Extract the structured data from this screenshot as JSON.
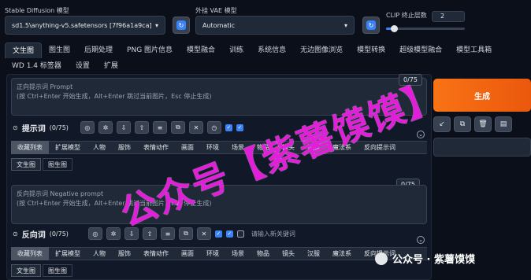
{
  "top": {
    "sd_model_label": "Stable Diffusion 模型",
    "sd_model_value": "sd1.5\\anything-v5.safetensors [7f96a1a9ca]",
    "vae_label": "外挂 VAE 模型",
    "vae_value": "Automatic",
    "clip_label": "CLIP 终止层数",
    "clip_value": "2",
    "clip_fraction": 0.1
  },
  "main_tabs": [
    "文生图",
    "图生图",
    "后期处理",
    "PNG 图片信息",
    "模型融合",
    "训练",
    "系统信息",
    "无边图像浏览",
    "模型转换",
    "超级模型融合",
    "模型工具箱",
    "WD 1.4 标签器",
    "设置",
    "扩展"
  ],
  "prompt": {
    "placeholder_line1": "正向提示词 Prompt",
    "placeholder_line2": "(按 Ctrl+Enter 开始生成，Alt+Enter 跳过当前图片，Esc 停止生成)",
    "counter": "0/75",
    "title": "提示词",
    "title_count": "(0/75)"
  },
  "negative": {
    "placeholder_line1": "反向提示词 Negative prompt",
    "placeholder_line2": "(按 Ctrl+Enter 开始生成，Alt+Enter 跳过当前图片，Esc 停止生成)",
    "counter": "0/75",
    "title": "反向词",
    "title_count": "(0/75)",
    "keyword_placeholder": "请输入新关键词"
  },
  "category_tabs": [
    "收藏列表",
    "扩展模型",
    "人物",
    "服饰",
    "表情动作",
    "画面",
    "环境",
    "场景",
    "物品",
    "镜头",
    "汉服",
    "魔法系",
    "反向提示词"
  ],
  "sub_tabs": [
    "文生图",
    "图生图"
  ],
  "generate_label": "生成",
  "watermark": {
    "main": "公众号【紫薯馍馍】",
    "footer": "公众号 · 紫薯馍馍"
  },
  "colors": {
    "accent_orange": "#f97316",
    "checkbox_blue": "#3b82f6",
    "watermark_magenta": "#e11fd8"
  }
}
